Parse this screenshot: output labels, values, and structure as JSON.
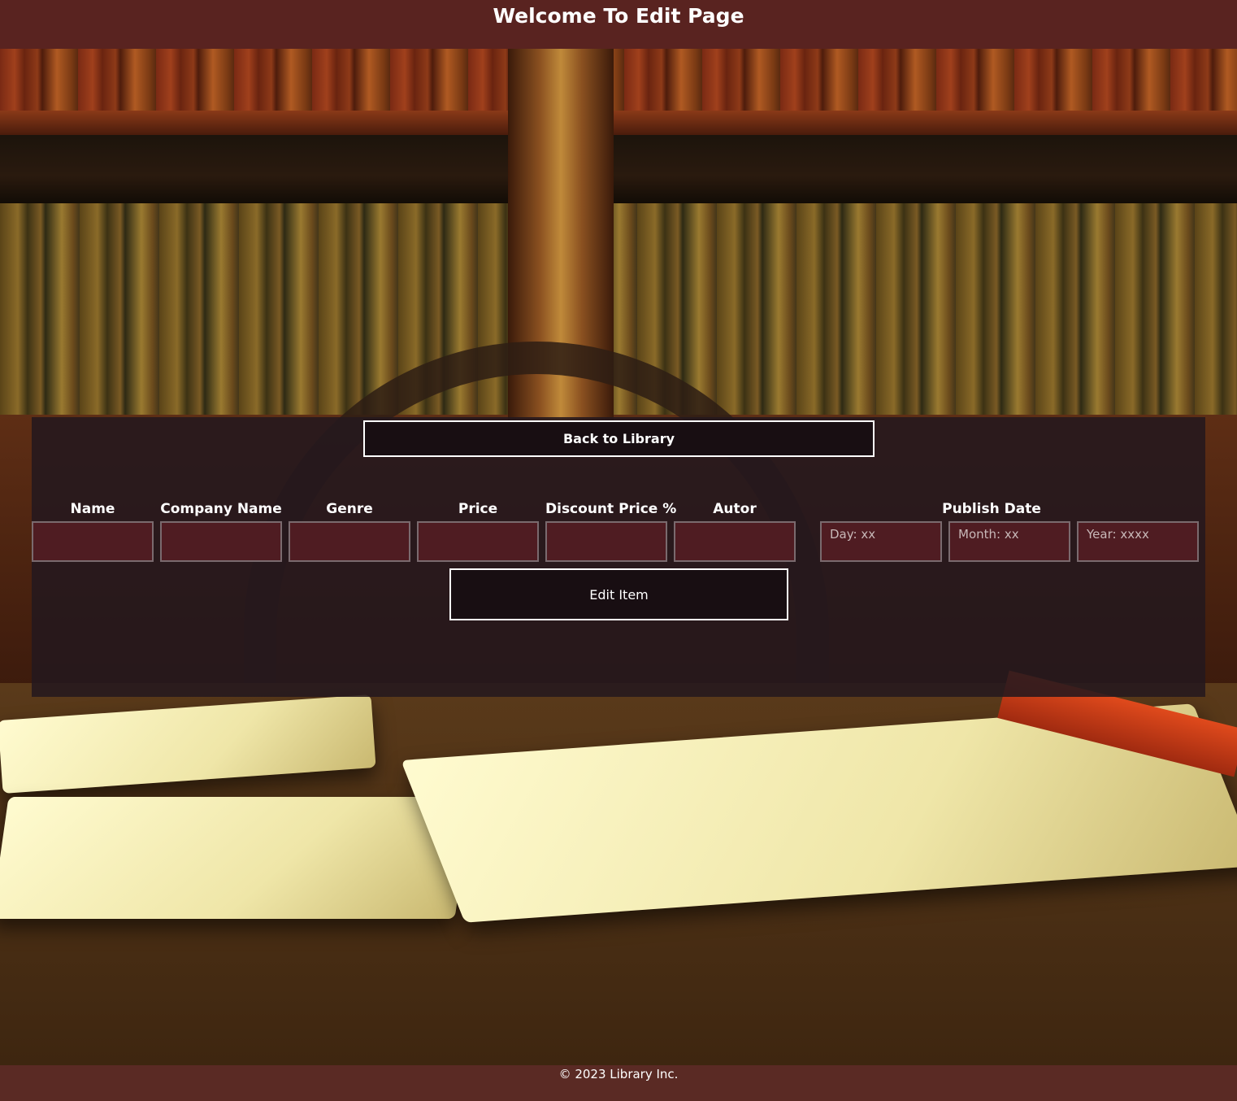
{
  "header": {
    "title": "Welcome To Edit Page"
  },
  "panel": {
    "back_label": "Back to Library",
    "fields": [
      {
        "label": "Name",
        "value": ""
      },
      {
        "label": "Company Name",
        "value": ""
      },
      {
        "label": "Genre",
        "value": ""
      },
      {
        "label": "Price",
        "value": ""
      },
      {
        "label": "Discount Price %",
        "value": ""
      },
      {
        "label": "Autor",
        "value": ""
      }
    ],
    "publish_date": {
      "label": "Publish Date",
      "day_placeholder": "Day: xx",
      "month_placeholder": "Month: xx",
      "year_placeholder": "Year: xxxx"
    },
    "edit_label": "Edit Item"
  },
  "footer": {
    "text": "© 2023 Library Inc."
  },
  "colors": {
    "header_bg": "#5c2422",
    "footer_bg": "#5a2a24",
    "panel_bg": "#24181e",
    "input_bg": "#4f1c22",
    "button_border": "#ffffff"
  }
}
